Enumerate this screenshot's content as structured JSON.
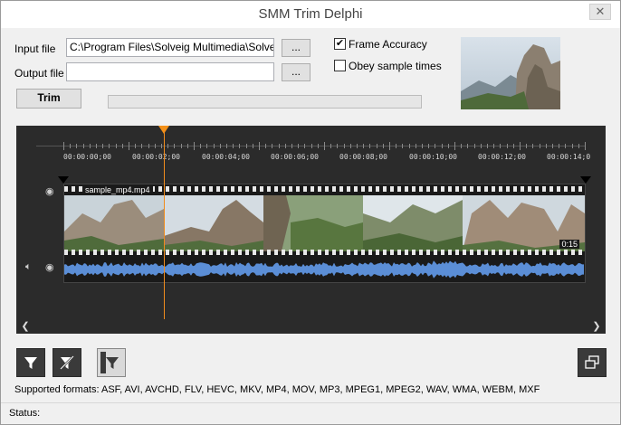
{
  "window": {
    "title": "SMM Trim Delphi",
    "close_glyph": "✕"
  },
  "form": {
    "input_label": "Input file",
    "input_value": "C:\\Program Files\\Solveig Multimedia\\SolveigMM",
    "output_label": "Output file",
    "output_value": "",
    "browse_label": "...",
    "trim_label": "Trim",
    "progress": 0
  },
  "options": {
    "frame_accuracy": {
      "label": "Frame Accuracy",
      "checked": true
    },
    "obey_sample_times": {
      "label": "Obey sample times",
      "checked": false
    }
  },
  "timeline": {
    "ticks": [
      "00:00:00;00",
      "00:00:02;00",
      "00:00:04;00",
      "00:00:06;00",
      "00:00:08;00",
      "00:00:10;00",
      "00:00:12;00",
      "00:00:14;0"
    ],
    "clip_name": "sample_mp4.mp4",
    "clip_end_time": "0:15",
    "cursor_time_seconds": 2.0
  },
  "toolbar": {
    "buttons": [
      "filter-icon",
      "no-filter-icon",
      "filter-active-icon"
    ],
    "restore_icon": "restore-window-icon"
  },
  "supported_formats": "Supported formats: ASF, AVI, AVCHD, FLV, HEVC, MKV, MP4, MOV, MP3, MPEG1, MPEG2, WAV, WMA, WEBM, MXF",
  "status": {
    "label": "Status:"
  },
  "colors": {
    "cursor": "#f39018",
    "waveform": "#5b8ed6",
    "timeline_bg": "#2b2b2b"
  }
}
